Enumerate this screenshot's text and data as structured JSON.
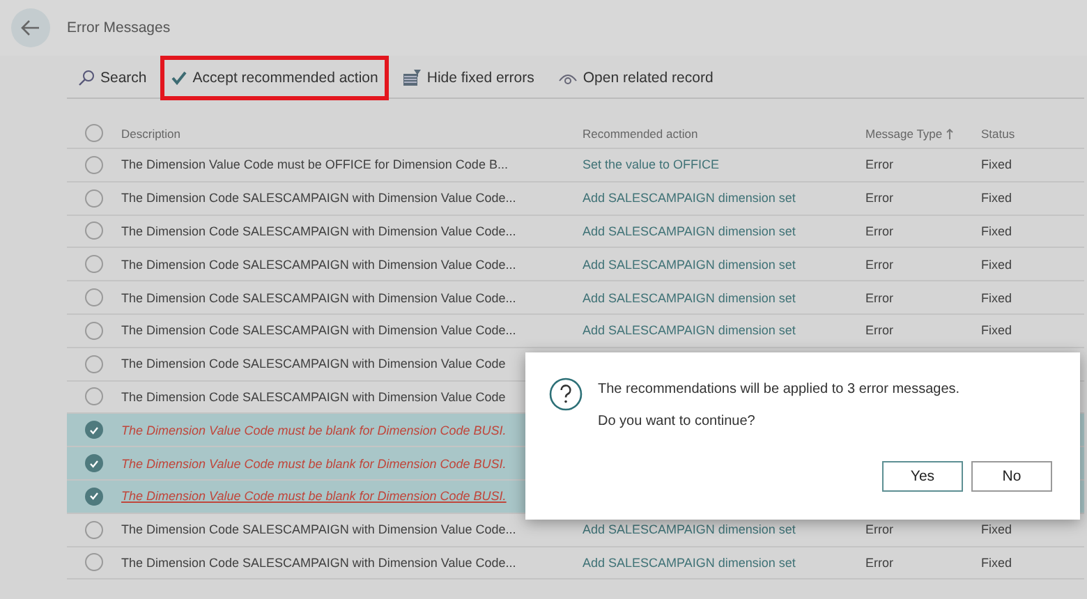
{
  "page": {
    "title": "Error Messages"
  },
  "toolbar": [
    {
      "kind": "search",
      "label": "Search",
      "highlighted": false
    },
    {
      "kind": "accept",
      "label": "Accept recommended action",
      "highlighted": true
    },
    {
      "kind": "hide",
      "label": "Hide fixed errors",
      "highlighted": false
    },
    {
      "kind": "open",
      "label": "Open related record",
      "highlighted": false
    }
  ],
  "table": {
    "all_selected": false,
    "columns": [
      "Description",
      "Recommended action",
      "Message Type",
      "Status"
    ],
    "rows": [
      {
        "selected": false,
        "kind": "normal",
        "focused": false,
        "description": "The Dimension Value Code must be OFFICE for Dimension Code B...",
        "recommended_action": "Set the value to OFFICE",
        "message_type": "Error",
        "status": "Fixed"
      },
      {
        "selected": false,
        "kind": "normal",
        "focused": false,
        "description": "The Dimension Code SALESCAMPAIGN with Dimension Value Code...",
        "recommended_action": "Add SALESCAMPAIGN dimension set",
        "message_type": "Error",
        "status": "Fixed"
      },
      {
        "selected": false,
        "kind": "normal",
        "focused": false,
        "description": "The Dimension Code SALESCAMPAIGN with Dimension Value Code...",
        "recommended_action": "Add SALESCAMPAIGN dimension set",
        "message_type": "Error",
        "status": "Fixed"
      },
      {
        "selected": false,
        "kind": "normal",
        "focused": false,
        "description": "The Dimension Code SALESCAMPAIGN with Dimension Value Code...",
        "recommended_action": "Add SALESCAMPAIGN dimension set",
        "message_type": "Error",
        "status": "Fixed"
      },
      {
        "selected": false,
        "kind": "normal",
        "focused": false,
        "description": "The Dimension Code SALESCAMPAIGN with Dimension Value Code...",
        "recommended_action": "Add SALESCAMPAIGN dimension set",
        "message_type": "Error",
        "status": "Fixed"
      },
      {
        "selected": false,
        "kind": "normal",
        "focused": false,
        "description": "The Dimension Code SALESCAMPAIGN with Dimension Value Code...",
        "recommended_action": "Add SALESCAMPAIGN dimension set",
        "message_type": "Error",
        "status": "Fixed"
      },
      {
        "selected": false,
        "kind": "normal",
        "focused": false,
        "description": "The Dimension Code SALESCAMPAIGN with Dimension Value Code"
      },
      {
        "selected": false,
        "kind": "normal",
        "focused": false,
        "description": "The Dimension Code SALESCAMPAIGN with Dimension Value Code"
      },
      {
        "selected": true,
        "kind": "attention",
        "focused": false,
        "description": "The Dimension Value Code must be blank for Dimension Code BUSI."
      },
      {
        "selected": true,
        "kind": "attention",
        "focused": false,
        "description": "The Dimension Value Code must be blank for Dimension Code BUSI."
      },
      {
        "selected": true,
        "kind": "attention",
        "focused": true,
        "description": "The Dimension Value Code must be blank for Dimension Code BUSI."
      },
      {
        "selected": false,
        "kind": "normal",
        "focused": false,
        "description": "The Dimension Code SALESCAMPAIGN with Dimension Value Code...",
        "recommended_action": "Add SALESCAMPAIGN dimension set",
        "message_type": "Error",
        "status": "Fixed"
      },
      {
        "selected": false,
        "kind": "normal",
        "focused": false,
        "description": "The Dimension Code SALESCAMPAIGN with Dimension Value Code...",
        "recommended_action": "Add SALESCAMPAIGN dimension set",
        "message_type": "Error",
        "status": "Fixed"
      }
    ]
  },
  "dialog": {
    "message": "The recommendations will be applied to 3 error messages.",
    "question": "Do you want to continue?",
    "buttons": [
      {
        "label": "Yes",
        "selected": true
      },
      {
        "label": "No",
        "selected": false
      }
    ]
  }
}
